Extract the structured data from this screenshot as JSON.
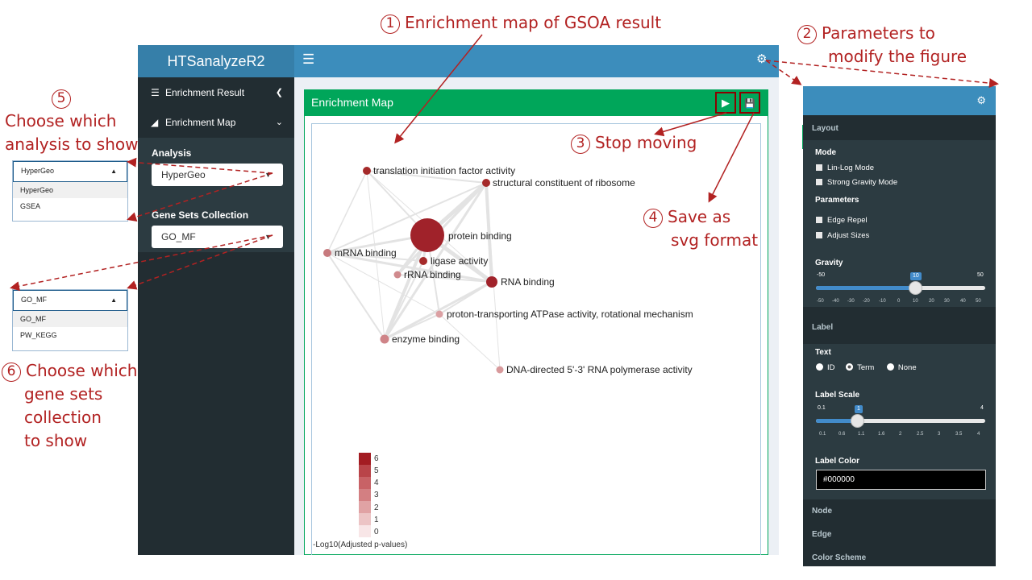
{
  "app": {
    "title": "HTSanalyzeR2",
    "menu_icon": "hamburger-icon",
    "settings_icon": "gears-icon"
  },
  "sidebar": {
    "items": [
      {
        "label": "Enrichment Result",
        "icon": "table-icon",
        "chevron": "chevron-left-icon"
      },
      {
        "label": "Enrichment Map",
        "icon": "area-chart-icon",
        "chevron": "chevron-down-icon"
      }
    ],
    "analysis_label": "Analysis",
    "analysis_value": "HyperGeo",
    "gene_sets_label": "Gene Sets Collection",
    "gene_sets_value": "GO_MF"
  },
  "main": {
    "box_title": "Enrichment Map",
    "play_icon": "play-icon",
    "save_icon": "save-icon"
  },
  "network": {
    "nodes": [
      {
        "label": "translation initiation factor activity",
        "color": "#a52a2a"
      },
      {
        "label": "structural constituent of ribosome",
        "color": "#a52a2a"
      },
      {
        "label": "protein binding",
        "color": "#a0222a"
      },
      {
        "label": "mRNA binding",
        "color": "#c77a7e"
      },
      {
        "label": "ligase activity",
        "color": "#a52a2a"
      },
      {
        "label": "rRNA binding",
        "color": "#d08a8d"
      },
      {
        "label": "RNA binding",
        "color": "#a0222a"
      },
      {
        "label": "proton-transporting ATPase activity, rotational mechanism",
        "color": "#dba0a3"
      },
      {
        "label": "enzyme binding",
        "color": "#cf8488"
      },
      {
        "label": "DNA-directed 5'-3' RNA polymerase activity",
        "color": "#d89a9c"
      }
    ],
    "legend": {
      "values": [
        "6",
        "5",
        "4",
        "3",
        "2",
        "1",
        "0"
      ],
      "colors": [
        "#a31c22",
        "#b94449",
        "#c86266",
        "#d37f82",
        "#e0a2a4",
        "#ecc4c5",
        "#f8e6e7"
      ],
      "title": "-Log10(Adjusted p-values)"
    }
  },
  "params": {
    "settings_icon": "gears-icon",
    "layout_heading": "Layout",
    "mode_label": "Mode",
    "mode_options": [
      "Lin-Log Mode",
      "Strong Gravity Mode"
    ],
    "parameters_label": "Parameters",
    "parameter_options": [
      "Edge Repel",
      "Adjust Sizes"
    ],
    "gravity_label": "Gravity",
    "gravity": {
      "min": "-50",
      "max": "50",
      "value": "10",
      "ticks": [
        "-50",
        "-40",
        "-30",
        "-20",
        "-10",
        "0",
        "10",
        "20",
        "30",
        "40",
        "50"
      ]
    },
    "label_heading": "Label",
    "text_label": "Text",
    "text_options": [
      "ID",
      "Term",
      "None"
    ],
    "label_scale_label": "Label Scale",
    "label_scale": {
      "min": "0.1",
      "max": "4",
      "value": "1",
      "ticks": [
        "0.1",
        "0.6",
        "1.1",
        "1.6",
        "2",
        "2.5",
        "3",
        "3.5",
        "4"
      ]
    },
    "label_color_label": "Label Color",
    "label_color_value": "#000000",
    "node_heading": "Node",
    "edge_heading": "Edge",
    "color_scheme_heading": "Color Scheme"
  },
  "dropdowns": {
    "analysis": {
      "value": "HyperGeo",
      "options": [
        "HyperGeo",
        "GSEA"
      ]
    },
    "gene_sets": {
      "value": "GO_MF",
      "options": [
        "GO_MF",
        "PW_KEGG"
      ]
    }
  },
  "annotations": {
    "a1": {
      "num": "1",
      "text": "Enrichment map of GSOA result"
    },
    "a2": {
      "num": "2",
      "line1": "Parameters to",
      "line2": "modify the figure"
    },
    "a3": {
      "num": "3",
      "text": "Stop moving"
    },
    "a4": {
      "num": "4",
      "line1": "Save as",
      "line2": "svg format"
    },
    "a5": {
      "num": "5",
      "line1": "Choose which",
      "line2": "analysis to show"
    },
    "a6": {
      "num": "6",
      "line1": "Choose which",
      "line2": "gene sets",
      "line3": "collection",
      "line4": "to show"
    }
  },
  "colors": {
    "header_dark": "#367fa9",
    "header": "#3c8dbc",
    "sidebar": "#222d32",
    "box_green": "#00a65a",
    "annotation_red": "#b22222"
  }
}
